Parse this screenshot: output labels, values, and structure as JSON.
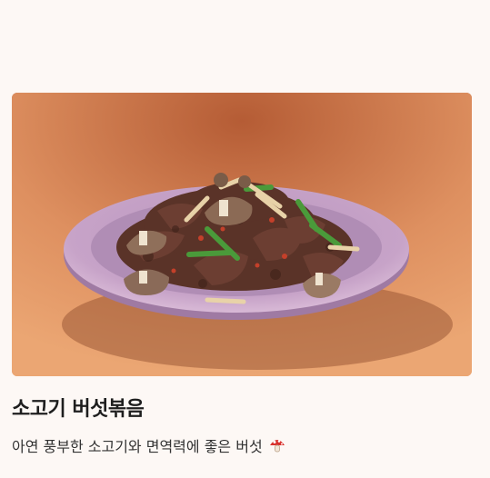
{
  "recipe": {
    "image_icon": "beef-mushroom-stir-fry-photo",
    "title": "소고기 버섯볶음",
    "description": "아연 풍부한 소고기와 면역력에 좋은 버섯",
    "emoji_icon": "mushroom-icon"
  },
  "colors": {
    "background": "#fdf8f5",
    "title": "#1e1e1e",
    "text": "#333333",
    "plate": "#c8a2c8"
  }
}
